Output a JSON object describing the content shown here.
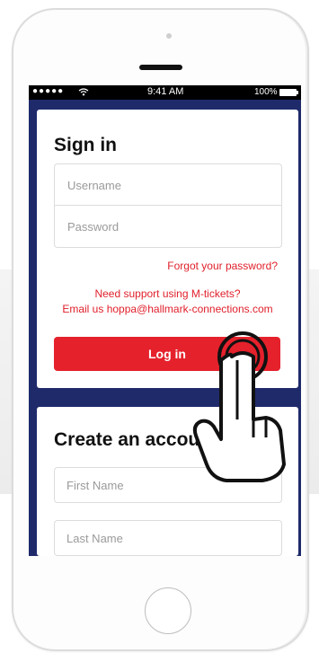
{
  "status_bar": {
    "signal": "●●●●●",
    "time": "9:41 AM",
    "battery": "100%"
  },
  "sign_in": {
    "title": "Sign in",
    "username_placeholder": "Username",
    "password_placeholder": "Password",
    "forgot_password": "Forgot your password?",
    "support_line1": "Need support using M-tickets?",
    "support_line2": "Email us hoppa@hallmark-connections.com",
    "login_button": "Log in"
  },
  "create_account": {
    "title": "Create an accou",
    "first_name_placeholder": "First Name",
    "last_name_placeholder": "Last Name"
  },
  "colors": {
    "accent": "#e5212c",
    "screen_background": "#1f2a6b"
  },
  "icons": [
    "wifi-icon",
    "battery-icon",
    "tap-hand-icon"
  ]
}
